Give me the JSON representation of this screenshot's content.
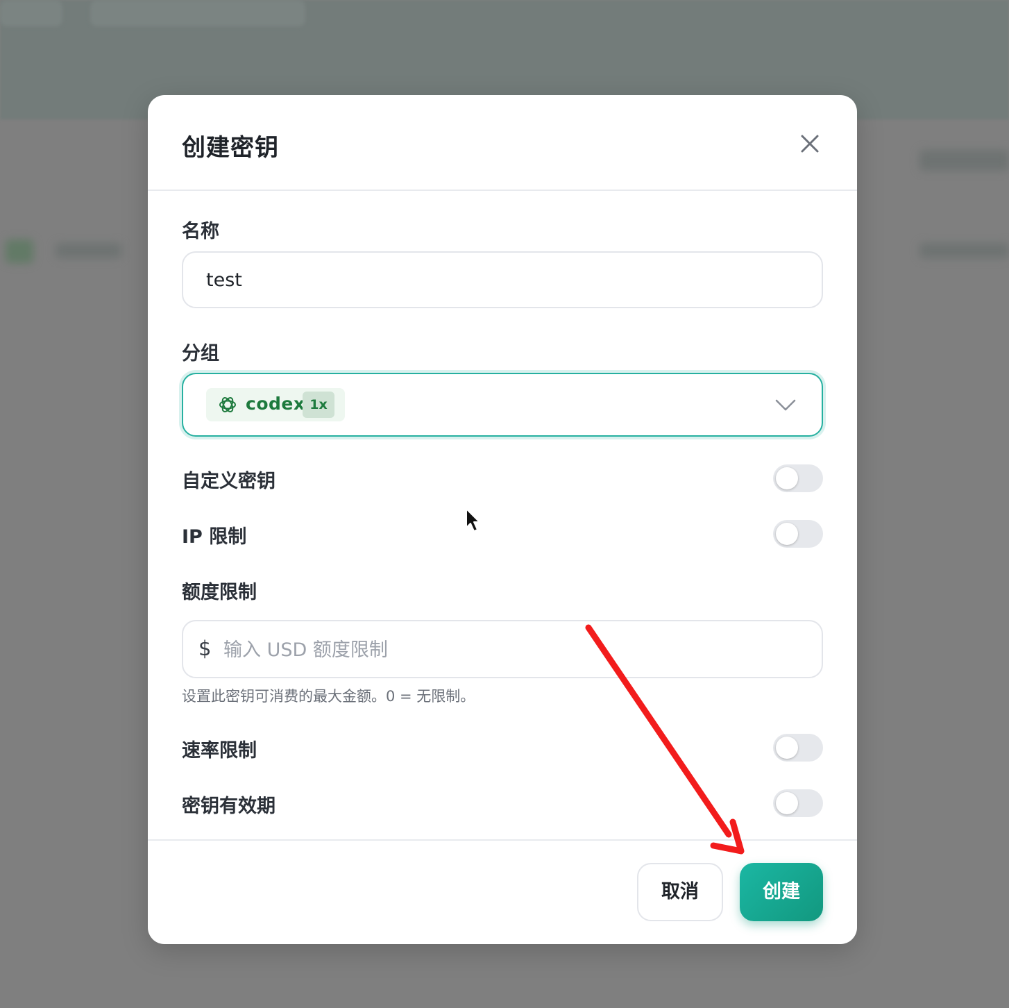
{
  "dialog": {
    "title": "创建密钥",
    "close_label": "close"
  },
  "form": {
    "name": {
      "label": "名称",
      "value": "test"
    },
    "group": {
      "label": "分组",
      "selected_name": "codex",
      "selected_multiplier": "1x",
      "icon": "openai-icon"
    },
    "custom_key": {
      "label": "自定义密钥",
      "enabled": false
    },
    "ip_limit": {
      "label": "IP 限制",
      "enabled": false
    },
    "quota": {
      "label": "额度限制",
      "prefix": "$",
      "placeholder": "输入 USD 额度限制",
      "value": "",
      "hint": "设置此密钥可消费的最大金额。0 = 无限制。"
    },
    "rate_limit": {
      "label": "速率限制",
      "enabled": false
    },
    "expiry": {
      "label": "密钥有效期",
      "enabled": false
    }
  },
  "footer": {
    "cancel_label": "取消",
    "create_label": "创建"
  },
  "colors": {
    "accent": "#1bb7a3",
    "chip_text": "#1d7a3d",
    "annotation_arrow": "#f21c1c"
  }
}
